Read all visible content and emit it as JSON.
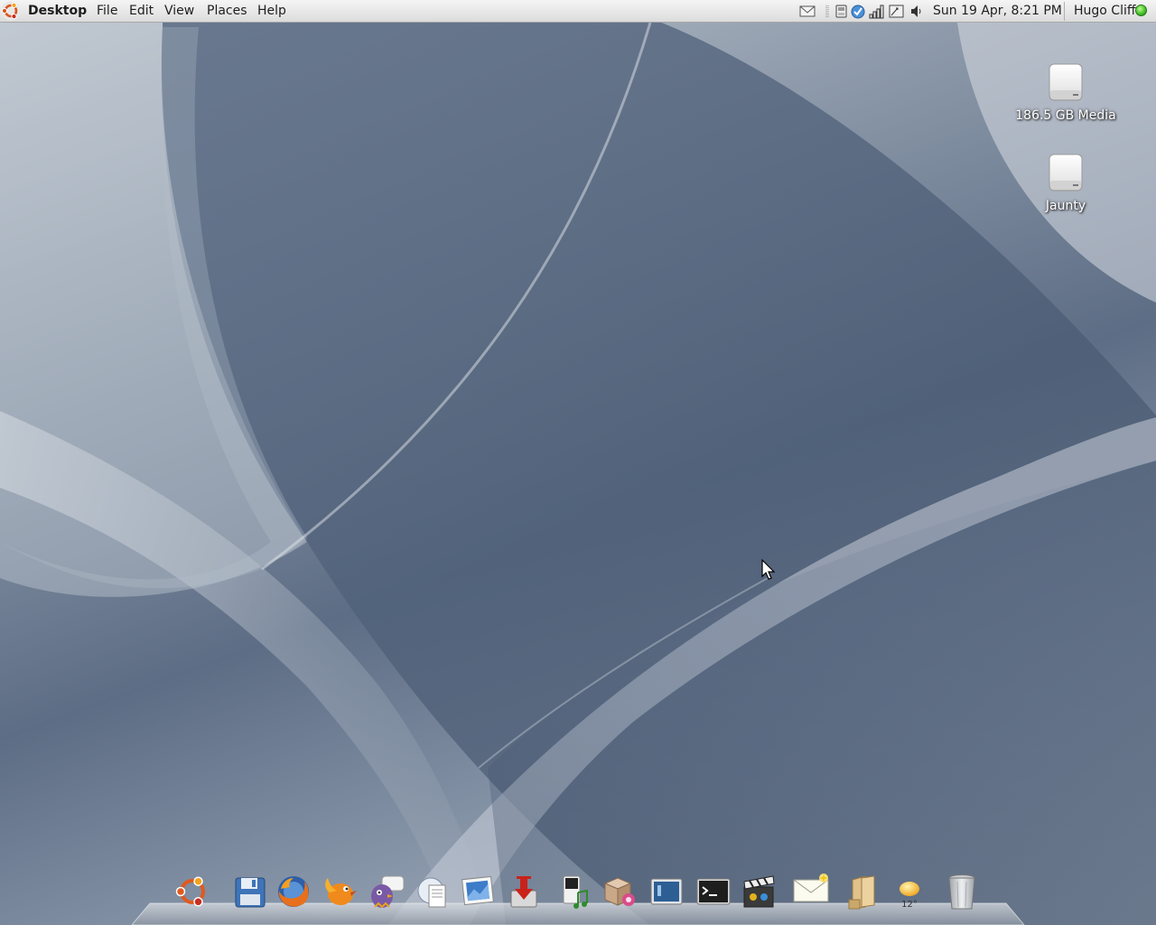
{
  "top_panel": {
    "app_title": "Desktop",
    "menus": [
      "File",
      "Edit",
      "View",
      "Places",
      "Help"
    ],
    "clock": "Sun 19 Apr,  8:21 PM",
    "user": "Hugo Cliff",
    "status_color": "#3fbf28",
    "tray_icons": [
      "mail-icon",
      "keyboard-icon",
      "update-icon",
      "network-signal-icon",
      "network-manager-icon",
      "volume-icon"
    ]
  },
  "desktop_icons": [
    {
      "label": "186.5 GB Media",
      "icon": "drive-icon"
    },
    {
      "label": "Jaunty",
      "icon": "drive-icon"
    }
  ],
  "dock": {
    "items": [
      {
        "name": "ubuntu-logo-icon"
      },
      {
        "name": "save-icon"
      },
      {
        "name": "firefox-icon"
      },
      {
        "name": "bird-icon"
      },
      {
        "name": "pidgin-icon"
      },
      {
        "name": "documents-icon"
      },
      {
        "name": "image-viewer-icon"
      },
      {
        "name": "download-icon"
      },
      {
        "name": "music-player-icon"
      },
      {
        "name": "software-package-icon"
      },
      {
        "name": "screen-icon"
      },
      {
        "name": "terminal-icon"
      },
      {
        "name": "movie-clapper-icon"
      },
      {
        "name": "new-mail-icon"
      },
      {
        "name": "files-icon"
      },
      {
        "name": "weather-icon"
      },
      {
        "name": "trash-icon"
      }
    ],
    "weather_temp": "12°"
  }
}
